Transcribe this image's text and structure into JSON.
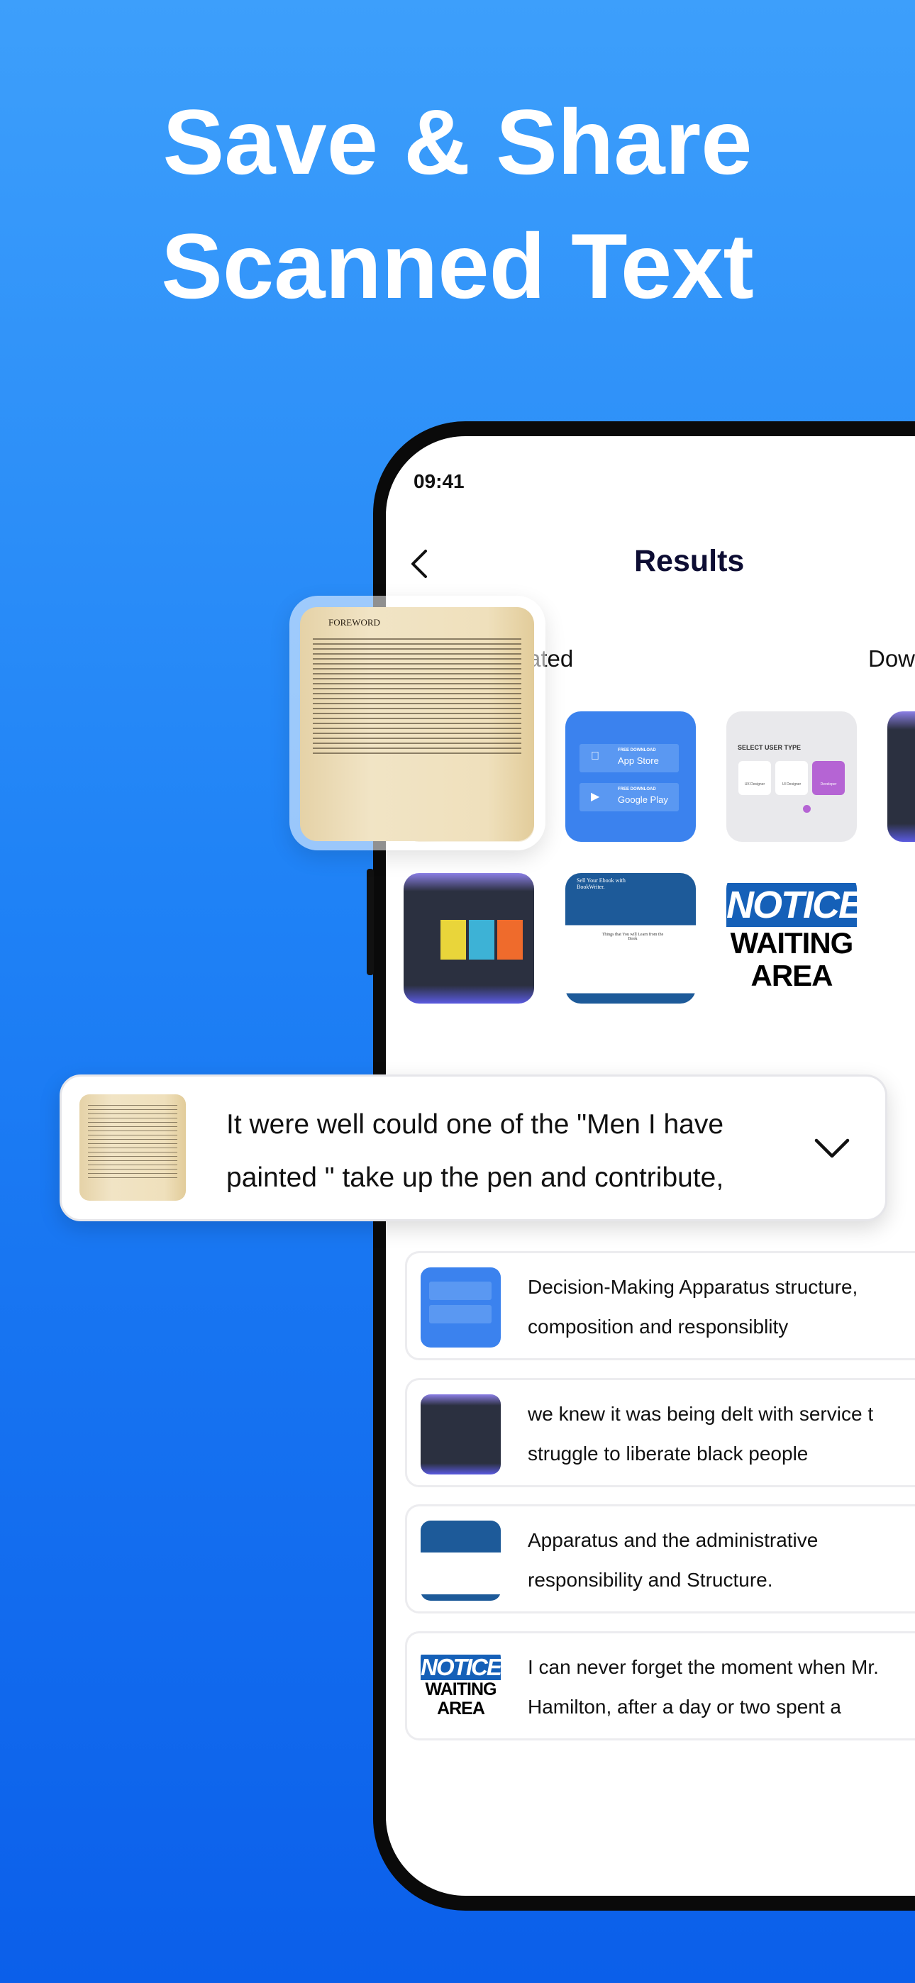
{
  "headline": {
    "line1": "Save & Share",
    "line2": "Scanned Text"
  },
  "status_bar": {
    "time": "09:41"
  },
  "header": {
    "title": "Results",
    "back_icon": "chevron-left-icon"
  },
  "tabs": [
    {
      "label": "ated"
    },
    {
      "label": "Dow"
    }
  ],
  "grid": {
    "items": [
      {
        "type": "app-store-buttons",
        "free": "FREE DOWNLOAD",
        "store1": "App Store",
        "store2": "Google Play"
      },
      {
        "type": "select-user-type",
        "heading": "SELECT USER TYPE",
        "options": [
          "UX Designer",
          "UI Designer",
          "Developer"
        ]
      },
      {
        "type": "music-app"
      },
      {
        "type": "ebook-page",
        "heading": "Sell Your Ebook with BookWriter.",
        "sub": "Things that You will Learn from the Book"
      },
      {
        "type": "notice-sign",
        "line1": "NOTICE",
        "line2": "WAITING",
        "line3": "AREA"
      }
    ]
  },
  "floating_scan": {
    "heading": "FOREWORD"
  },
  "expanded_card": {
    "text_line1": "It were well could one of the \"Men I have",
    "text_line2": "painted \" take up the pen and contribute,",
    "chevron_icon": "chevron-down-icon"
  },
  "results": [
    {
      "line1": "Decision-Making Apparatus structure,",
      "line2": "composition and responsiblity"
    },
    {
      "line1": "we knew it was being delt with service t",
      "line2": "struggle to liberate black people"
    },
    {
      "line1": "Apparatus and the administrative",
      "line2": "responsibility and Structure."
    },
    {
      "line1": "I can never forget the moment when Mr.",
      "line2": "Hamilton, after a day or two spent a"
    }
  ],
  "colors": {
    "accent": "#1f82f6",
    "title": "#0d0d33",
    "app_blue": "#3b82ee",
    "notice_blue": "#1560b8"
  }
}
